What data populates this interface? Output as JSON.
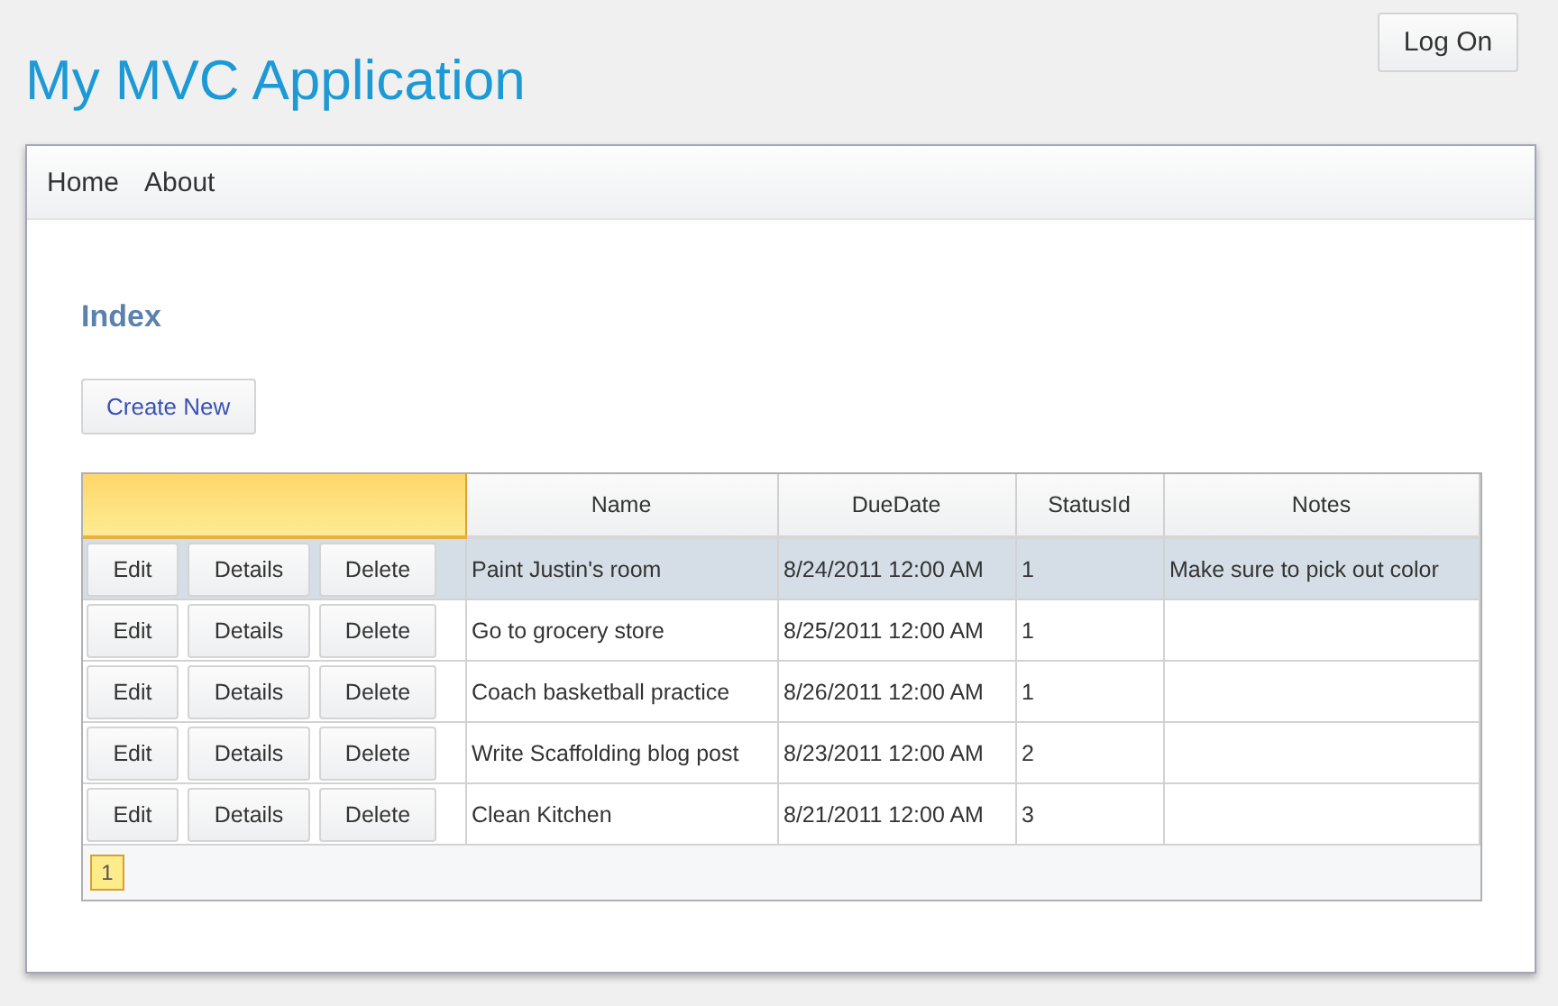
{
  "header": {
    "title": "My MVC Application",
    "login_button": "Log On"
  },
  "nav": [
    {
      "label": "Home"
    },
    {
      "label": "About"
    }
  ],
  "page": {
    "heading": "Index",
    "create_button": "Create New"
  },
  "table": {
    "columns": [
      {
        "highlighted": true
      },
      {
        "label": "Name",
        "highlighted": false
      },
      {
        "label": "DueDate",
        "highlighted": false
      },
      {
        "label": "StatusId",
        "highlighted": false
      },
      {
        "label": "Notes",
        "highlighted": false
      }
    ],
    "rows": [
      {
        "selected": true,
        "actions": [
          "Edit",
          "Details",
          "Delete"
        ],
        "name": "Paint Justin's room",
        "due_date": "8/24/2011 12:00 AM",
        "status_id": "1",
        "notes": "Make sure to pick out color"
      },
      {
        "selected": false,
        "actions": [
          "Edit",
          "Details",
          "Delete"
        ],
        "name": "Go to grocery store",
        "due_date": "8/25/2011 12:00 AM",
        "status_id": "1"
      },
      {
        "selected": false,
        "actions": [
          "Edit",
          "Details",
          "Delete"
        ],
        "name": "Coach basketball practice",
        "due_date": "8/26/2011 12:00 AM",
        "status_id": "1"
      },
      {
        "selected": false,
        "actions": [
          "Edit",
          "Details",
          "Delete"
        ],
        "name": "Write Scaffolding blog post",
        "due_date": "8/23/2011 12:00 AM",
        "status_id": "2"
      },
      {
        "selected": false,
        "actions": [
          "Edit",
          "Details",
          "Delete"
        ],
        "name": "Clean Kitchen",
        "due_date": "8/21/2011 12:00 AM",
        "status_id": "3"
      }
    ],
    "pager": [
      {
        "label": "1",
        "selected": true
      }
    ]
  }
}
